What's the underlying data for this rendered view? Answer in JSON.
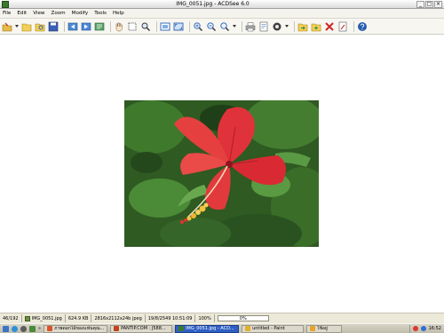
{
  "window": {
    "title": "IMG_0051.jpg - ACDSee 6.0",
    "minimize_glyph": "_",
    "maximize_glyph": "□",
    "close_glyph": "×"
  },
  "menu": [
    "File",
    "Edit",
    "View",
    "Zoom",
    "Modify",
    "Tools",
    "Help"
  ],
  "toolbar": {
    "icons": [
      "open-icon",
      "folder-icon",
      "browse-icon",
      "save-icon",
      "previous-image-icon",
      "next-image-icon",
      "auto-advance-icon",
      "hand-tool-icon",
      "select-tool-icon",
      "magnifier-icon",
      "fit-image-icon",
      "full-screen-icon",
      "zoom-in-icon",
      "zoom-out-icon",
      "zoom-menu-icon",
      "print-icon",
      "properties-icon",
      "rotate-icon",
      "move-to-icon",
      "copy-to-icon",
      "delete-icon",
      "edit-icon",
      "help-icon"
    ]
  },
  "status": {
    "position": "46/192",
    "filename": "IMG_0051.jpg",
    "size": "624.9 KB",
    "dimensions": "2816x2112x24b jpeg",
    "date": "19/8/2549 10:51:09",
    "zoom": "100%",
    "progress": "0%",
    "progress_value": 0
  },
  "taskbar": {
    "tasks": [
      {
        "label": "ภาพดอกไม้ของแฟนคุณ...",
        "icon_color": "#d9532a"
      },
      {
        "label": "PANTIP.COM : J588...",
        "icon_color": "#c2421c"
      },
      {
        "label": "IMG_0051.jpg - ACD...",
        "icon_color": "#3c7a2c"
      },
      {
        "label": "untitled - Paint",
        "icon_color": "#e0b12c"
      },
      {
        "label": "ใช้อยู่",
        "icon_color": "#e8a32a"
      }
    ],
    "clock": "16:52",
    "active_color": "#2f5fc4"
  },
  "colors": {
    "viewer_background": "#ffffff",
    "chrome": "#ece9d8",
    "flower": "#e0323a",
    "foliage": "#2f5a22"
  }
}
